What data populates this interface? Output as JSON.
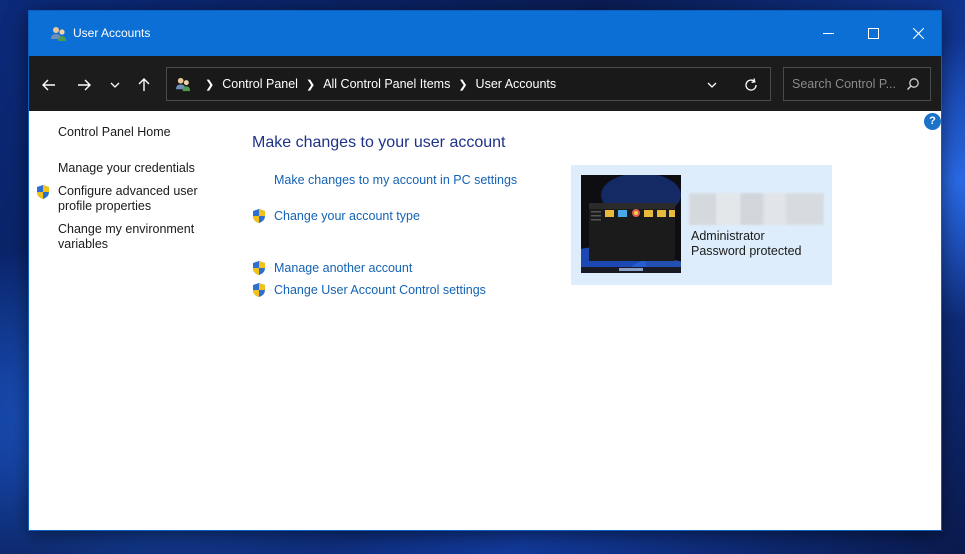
{
  "window": {
    "title": "User Accounts"
  },
  "navigation": {
    "breadcrumbs": [
      "Control Panel",
      "All Control Panel Items",
      "User Accounts"
    ],
    "search_placeholder": "Search Control P..."
  },
  "sidebar": {
    "home": "Control Panel Home",
    "links": [
      {
        "label": "Manage your credentials",
        "shield": false
      },
      {
        "label_line1": "Configure advanced user",
        "label_line2": "profile properties",
        "shield": true
      },
      {
        "label_line1": "Change my environment",
        "label_line2": "variables",
        "shield": false
      }
    ]
  },
  "main": {
    "heading": "Make changes to your user account",
    "tasks": [
      {
        "label": "Make changes to my account in PC settings",
        "shield": false
      },
      {
        "label": "Change your account type",
        "shield": true
      },
      {
        "label": "Manage another account",
        "shield": true
      },
      {
        "label": "Change User Account Control settings",
        "shield": true
      }
    ]
  },
  "account": {
    "role": "Administrator",
    "status": "Password protected"
  },
  "help": {
    "glyph": "?"
  },
  "colors": {
    "titlebar": "#0b6fd6",
    "navbar": "#1c1c1c",
    "heading": "#1e3287",
    "link": "#1463b4",
    "card": "#deedfb"
  }
}
